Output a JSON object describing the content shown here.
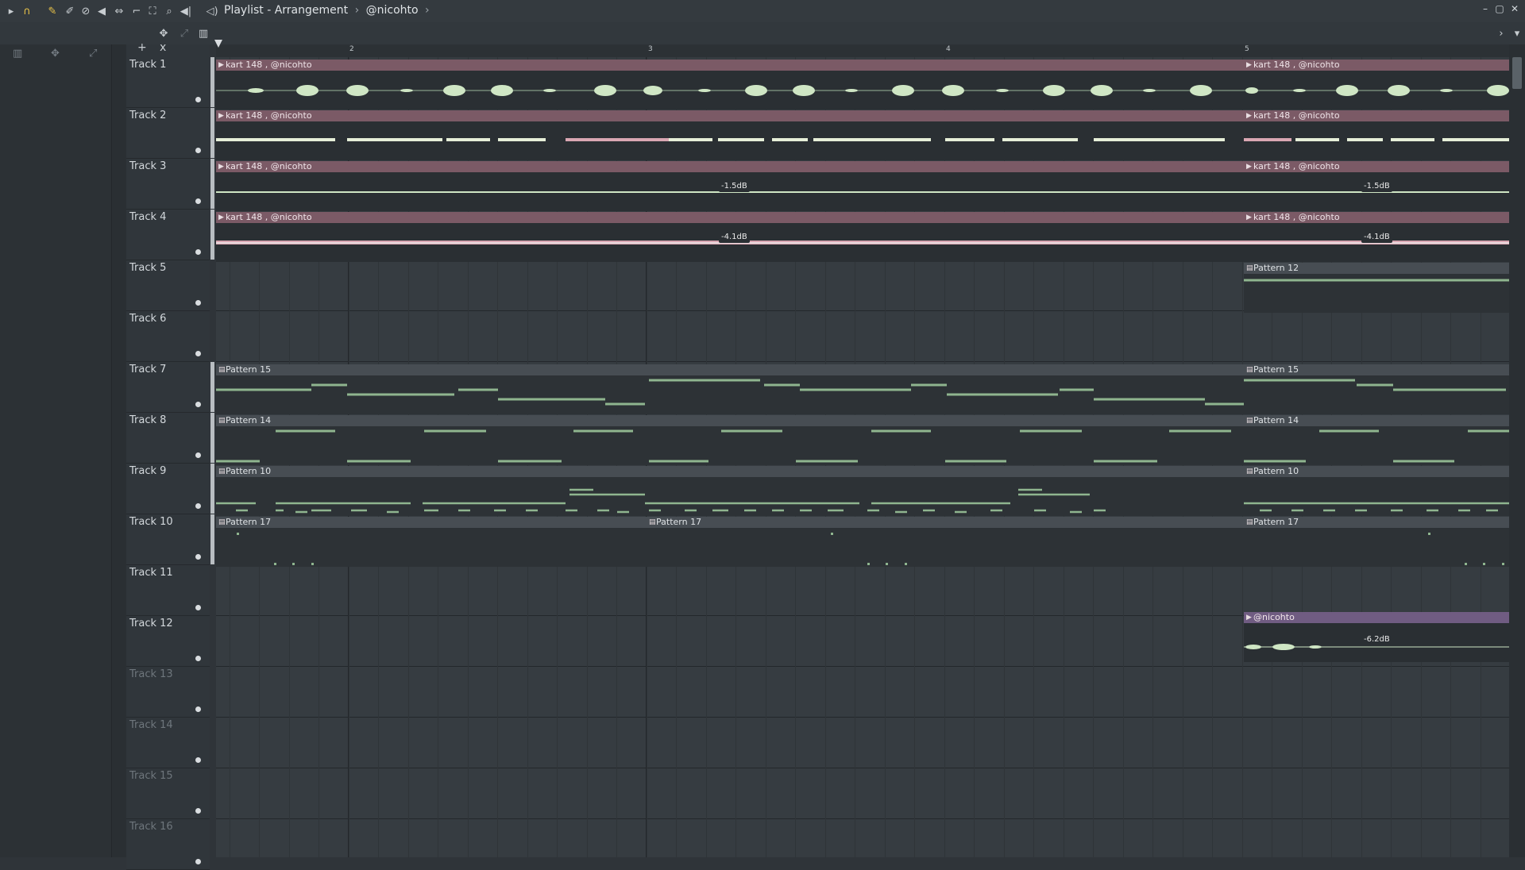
{
  "window": {
    "title_parts": [
      "Playlist - Arrangement",
      "@nicohto"
    ],
    "separator": "›",
    "controls": [
      "–",
      "▢",
      "✕"
    ]
  },
  "toolbar": {
    "icons": [
      "arrow-icon",
      "magnet-icon",
      "pencil-icon",
      "paint-icon",
      "delete-icon",
      "mute-icon",
      "slip-icon",
      "select-icon",
      "zoom-icon",
      "playback-icon",
      "speaker-icon"
    ],
    "tools": [
      "+",
      "x"
    ]
  },
  "ruler": {
    "marks": [
      "2",
      "3",
      "4",
      "5"
    ]
  },
  "tracks": [
    {
      "name": "Track 1",
      "dim": false
    },
    {
      "name": "Track 2",
      "dim": false
    },
    {
      "name": "Track 3",
      "dim": false
    },
    {
      "name": "Track 4",
      "dim": false
    },
    {
      "name": "Track 5",
      "dim": false
    },
    {
      "name": "Track 6",
      "dim": false
    },
    {
      "name": "Track 7",
      "dim": false
    },
    {
      "name": "Track 8",
      "dim": false
    },
    {
      "name": "Track 9",
      "dim": false
    },
    {
      "name": "Track 10",
      "dim": false
    },
    {
      "name": "Track 11",
      "dim": false
    },
    {
      "name": "Track 12",
      "dim": false
    },
    {
      "name": "Track 13",
      "dim": true
    },
    {
      "name": "Track 14",
      "dim": true
    },
    {
      "name": "Track 15",
      "dim": true
    },
    {
      "name": "Track 16",
      "dim": true
    }
  ],
  "clips": {
    "audio_label": "kart 148 , @nicohto",
    "purple_label": "@nicohto",
    "pattern_12": "Pattern 12",
    "pattern_15": "Pattern 15",
    "pattern_14": "Pattern 14",
    "pattern_10": "Pattern 10",
    "pattern_17": "Pattern 17",
    "gain_track3": "-1.5dB",
    "gain_track4": "-4.1dB",
    "gain_track12": "-6.2dB"
  },
  "colors": {
    "audio_clip_header": "#7b5a66",
    "pattern_clip_header": "#474d53",
    "purple_clip_header": "#705c82",
    "note_green": "#8fb58f",
    "wave_green": "#cfe6c4",
    "wave_pink": "#d9a7b3"
  }
}
